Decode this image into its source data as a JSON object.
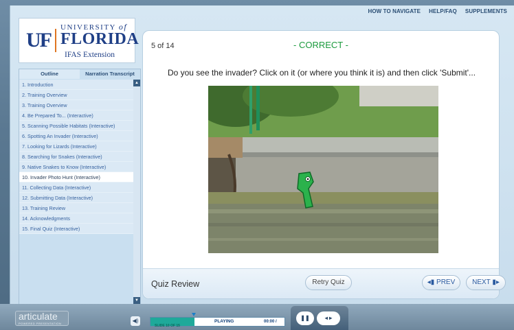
{
  "top_links": [
    "HOW TO NAVIGATE",
    "HELP/FAQ",
    "SUPPLEMENTS"
  ],
  "logo": {
    "uf": "UF",
    "university": "UNIVERSITY",
    "of": "of",
    "florida": "FLORIDA",
    "ifas": "IFAS Extension"
  },
  "sidebar": {
    "tabs": [
      "Outline",
      "Narration Transcript"
    ],
    "items": [
      "1. Introduction",
      "2. Training Overview",
      "3. Training Overview",
      "4. Be Prepared To... (Interactive)",
      "5. Scanning Possible Habitats (Interactive)",
      "6. Spotting An Invader (Interactive)",
      "7. Looking for Lizards (Interactive)",
      "8. Searching for Snakes (Interactive)",
      "9. Native Snakes to Know (Interactive)",
      "10. Invader Photo Hunt (Interactive)",
      "11. Collecting Data (Interactive)",
      "12. Submitting Data (Interactive)",
      "13. Training Review",
      "14. Acknowledgments",
      "15. Final Quiz (Interactive)"
    ],
    "current_index": 9
  },
  "main": {
    "slide_count": "5 of 14",
    "status": "- CORRECT -",
    "question": "Do you see the invader? Click on it (or where you think it is) and then click 'Submit'...",
    "footer_title": "Quiz Review",
    "retry_label": "Retry Quiz",
    "prev_label": "◂▮ PREV",
    "next_label": "NEXT ▮▸"
  },
  "player": {
    "brand": "articulate",
    "brand_sub": "POWERED PRESENTATION",
    "slide_label": "SLIDE 10 OF 15",
    "status": "PLAYING",
    "time": "00:00 /",
    "progress_fraction": 0.33,
    "pause_icon": "pause-icon",
    "skip_icons": "rewind-forward-icon"
  },
  "colors": {
    "correct": "#1a9a3c",
    "accent": "#1fa99a",
    "nav_text": "#2a5aa0"
  }
}
